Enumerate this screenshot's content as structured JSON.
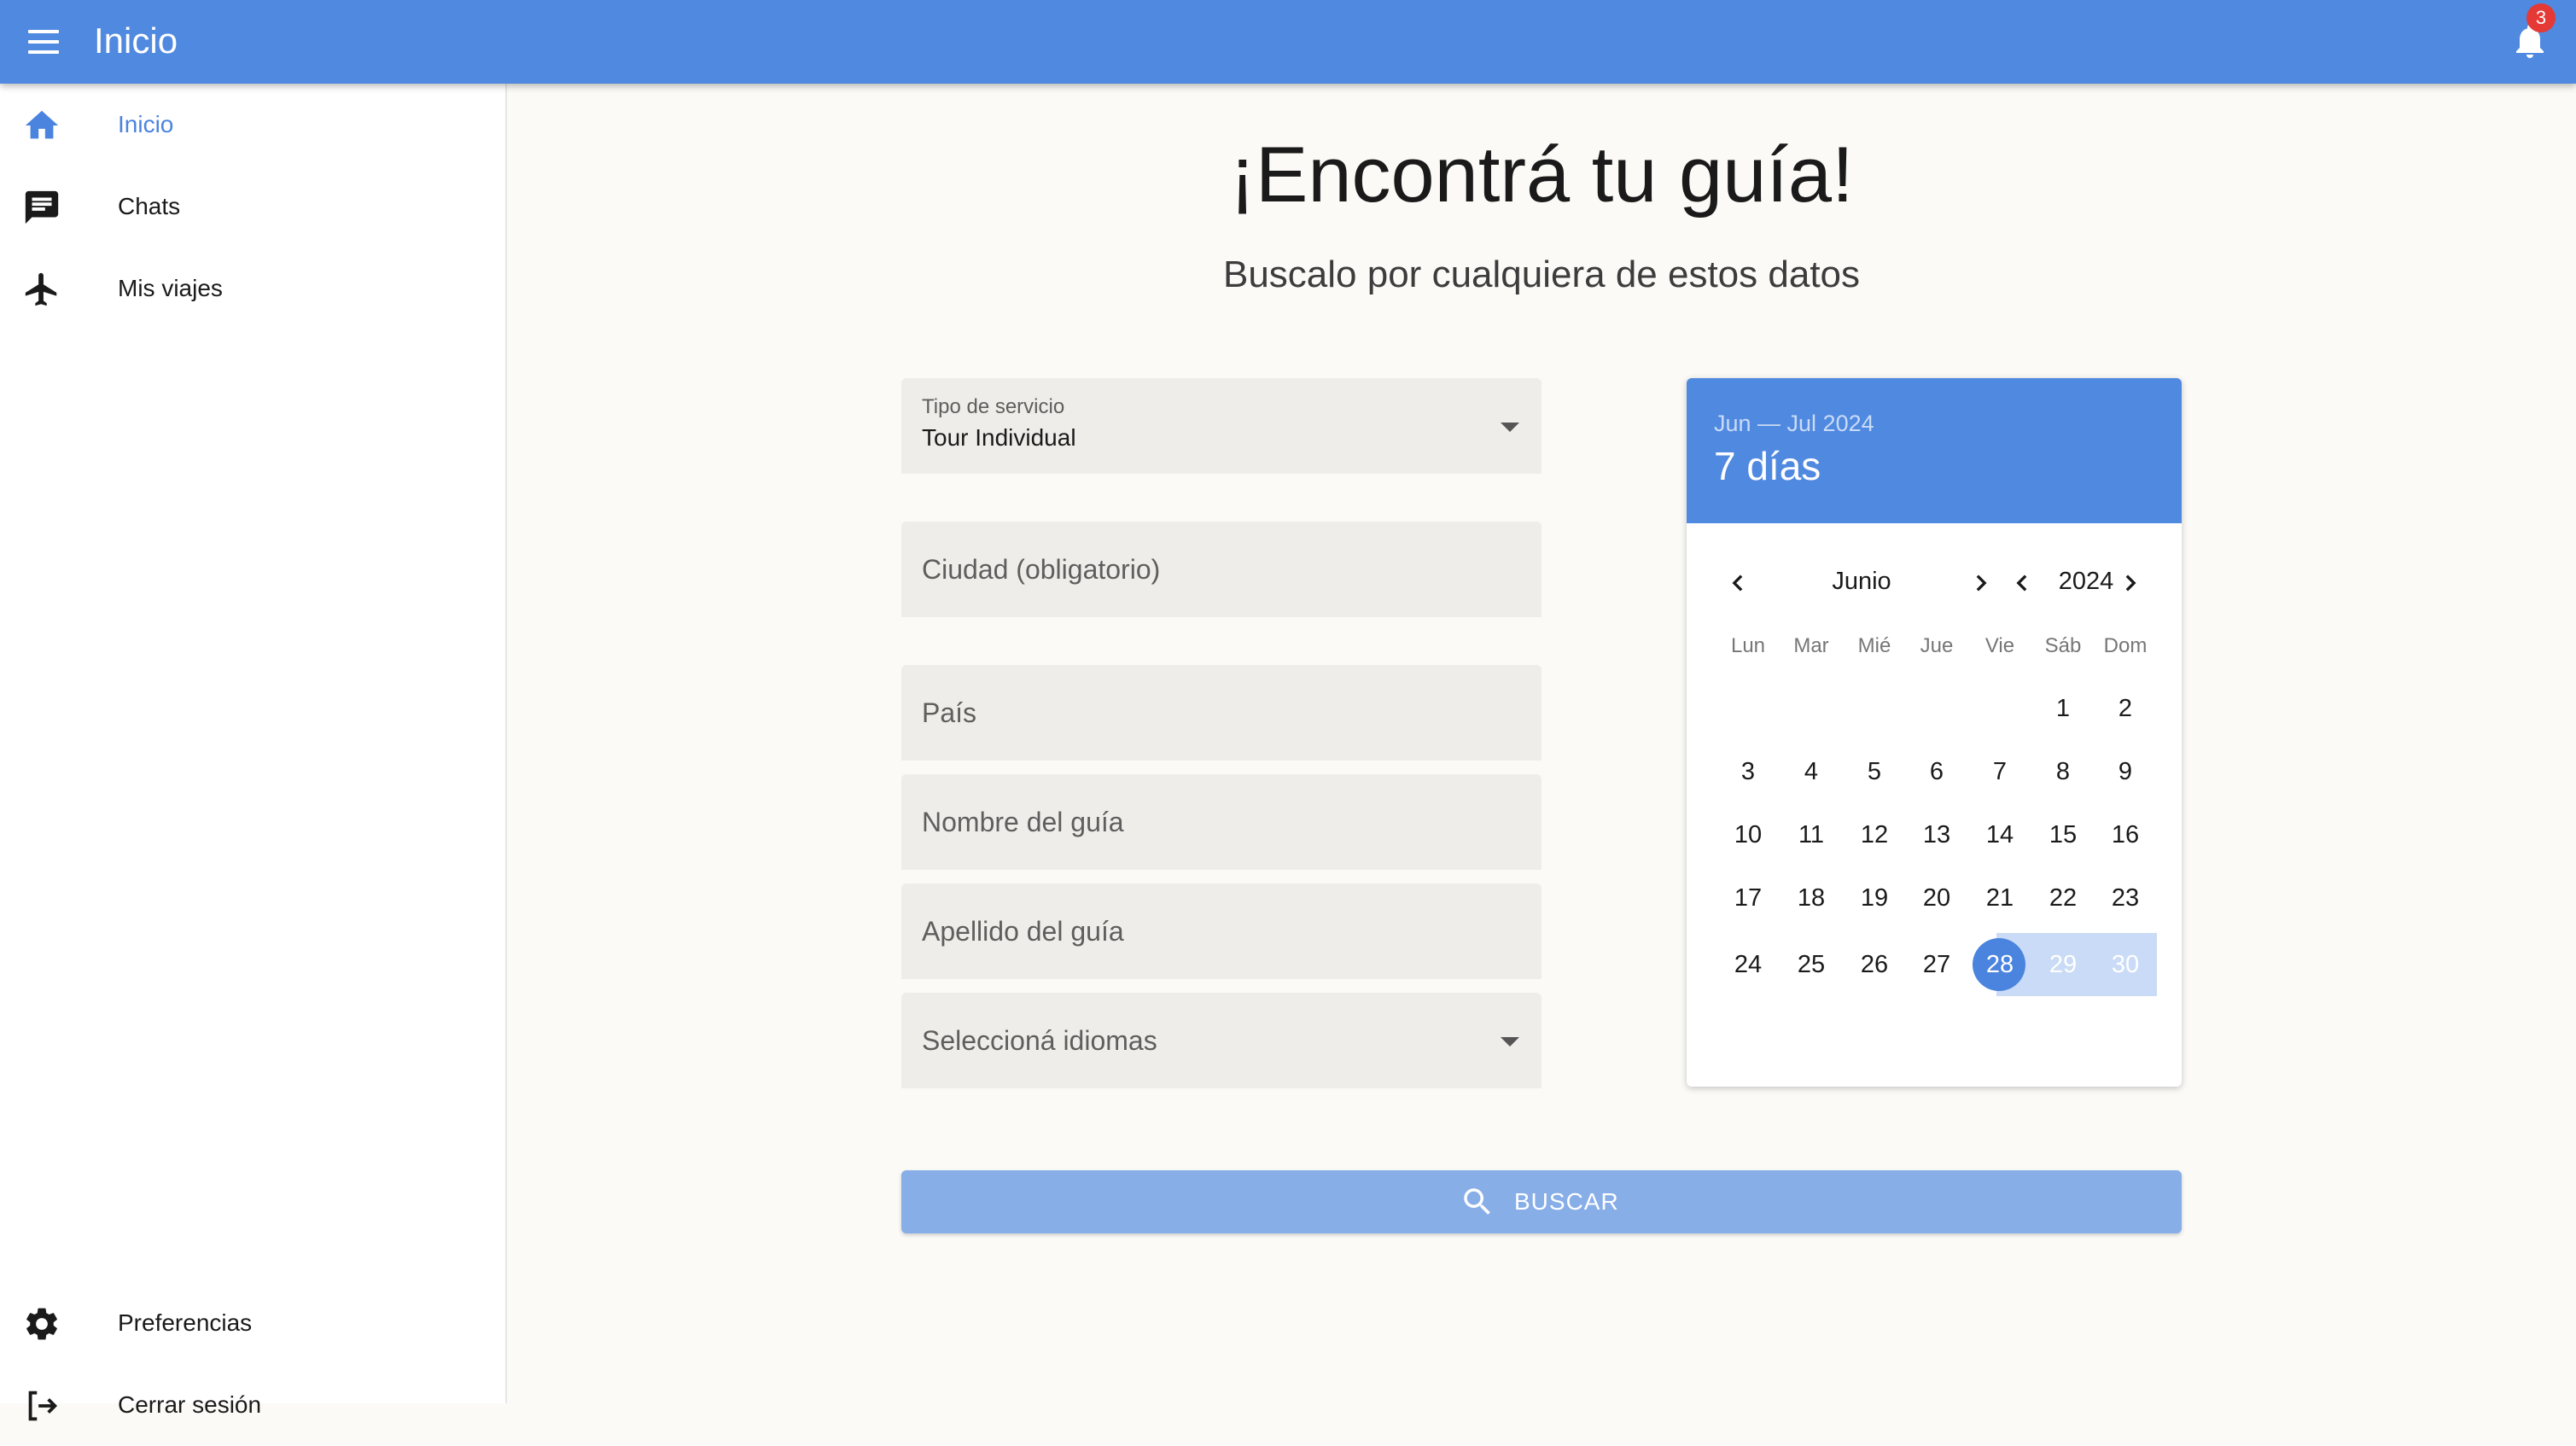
{
  "appbar": {
    "title": "Inicio",
    "notification_count": "3"
  },
  "sidebar": {
    "items": [
      {
        "label": "Inicio",
        "icon": "home-icon",
        "active": true
      },
      {
        "label": "Chats",
        "icon": "chat-icon"
      },
      {
        "label": "Mis viajes",
        "icon": "airplane-icon"
      }
    ],
    "bottom_items": [
      {
        "label": "Preferencias",
        "icon": "gear-icon"
      },
      {
        "label": "Cerrar sesión",
        "icon": "logout-icon"
      }
    ]
  },
  "main": {
    "headline": "¡Encontrá tu guía!",
    "subtitle": "Buscalo por cualquiera de estos datos"
  },
  "form": {
    "service_type": {
      "label": "Tipo de servicio",
      "value": "Tour Individual"
    },
    "city_placeholder": "Ciudad (obligatorio)",
    "country_placeholder": "País",
    "guide_name_placeholder": "Nombre del guía",
    "guide_lastname_placeholder": "Apellido del guía",
    "languages_placeholder": "Seleccioná idiomas",
    "search_label": "BUSCAR"
  },
  "calendar": {
    "range_label": "Jun — Jul 2024",
    "days_label": "7 días",
    "month": "Junio",
    "year": "2024",
    "weekdays": [
      "Lun",
      "Mar",
      "Mié",
      "Jue",
      "Vie",
      "Sáb",
      "Dom"
    ],
    "days": [
      "1",
      "2",
      "3",
      "4",
      "5",
      "6",
      "7",
      "8",
      "9",
      "10",
      "11",
      "12",
      "13",
      "14",
      "15",
      "16",
      "17",
      "18",
      "19",
      "20",
      "21",
      "22",
      "23",
      "24",
      "25",
      "26",
      "27",
      "28",
      "29",
      "30"
    ],
    "selected_start": "28",
    "range_days": [
      "29",
      "30"
    ]
  },
  "colors": {
    "primary": "#5089e0",
    "range_fill": "#c9dbf6",
    "badge": "#e53935",
    "button": "#88aee8"
  }
}
